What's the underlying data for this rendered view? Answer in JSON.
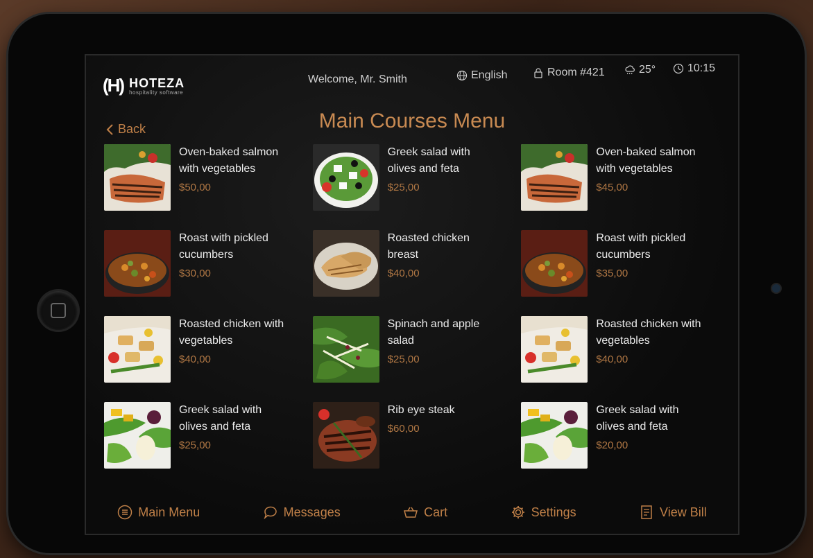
{
  "header": {
    "logo_name": "HOTEZA",
    "logo_tagline": "hospitality software",
    "welcome": "Welcome, Mr. Smith",
    "language": "English",
    "room": "Room #421",
    "temperature": "25°",
    "time": "10:15"
  },
  "back_label": "Back",
  "page_title": "Main Courses Menu",
  "menu": {
    "items": [
      {
        "name": "Oven-baked salmon with vegetables",
        "price": "$50,00",
        "image": "salmon"
      },
      {
        "name": "Greek salad with olives and feta",
        "price": "$25,00",
        "image": "greek-salad-bowl"
      },
      {
        "name": "Oven-baked salmon with vegetables",
        "price": "$45,00",
        "image": "salmon"
      },
      {
        "name": "Roast with pickled cucumbers",
        "price": "$30,00",
        "image": "roast"
      },
      {
        "name": "Roasted chicken breast",
        "price": "$40,00",
        "image": "chicken-breast"
      },
      {
        "name": "Roast with pickled cucumbers",
        "price": "$35,00",
        "image": "roast"
      },
      {
        "name": "Roasted chicken with vegetables",
        "price": "$40,00",
        "image": "chicken-veg"
      },
      {
        "name": "Spinach and apple salad",
        "price": "$25,00",
        "image": "spinach-salad"
      },
      {
        "name": "Roasted chicken with vegetables",
        "price": "$40,00",
        "image": "chicken-veg"
      },
      {
        "name": "Greek salad with olives and feta",
        "price": "$25,00",
        "image": "greek-salad-plate"
      },
      {
        "name": "Rib eye steak",
        "price": "$60,00",
        "image": "steak"
      },
      {
        "name": "Greek salad with olives and feta",
        "price": "$20,00",
        "image": "greek-salad-plate"
      }
    ]
  },
  "bottom_nav": {
    "main_menu": "Main Menu",
    "messages": "Messages",
    "cart": "Cart",
    "settings": "Settings",
    "view_bill": "View Bill"
  },
  "colors": {
    "accent": "#c08048",
    "price": "#b07744",
    "background": "#0b0b0b"
  }
}
